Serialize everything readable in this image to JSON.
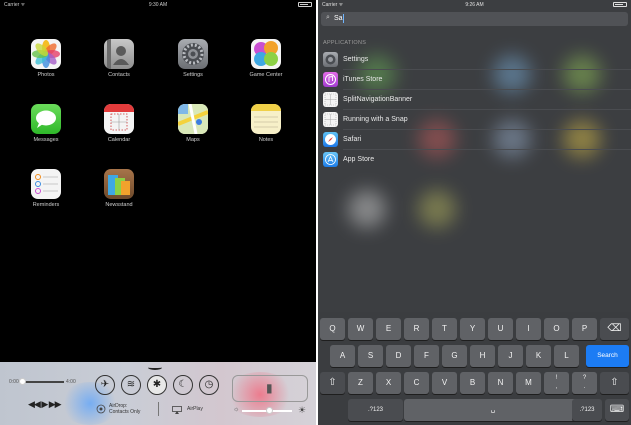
{
  "left": {
    "status": {
      "carrier": "Carrier ᯤ",
      "time": "9:30 AM"
    },
    "apps": [
      {
        "label": "Photos"
      },
      {
        "label": "Contacts"
      },
      {
        "label": "Settings"
      },
      {
        "label": "Game Center"
      },
      {
        "label": "Messages"
      },
      {
        "label": "Calendar"
      },
      {
        "label": "Maps"
      },
      {
        "label": "Notes"
      },
      {
        "label": "Reminders"
      },
      {
        "label": "Newsstand"
      }
    ],
    "control_center": {
      "time_start": "0:00",
      "time_end": "4:00",
      "toggles": [
        "✈",
        "≋",
        "✱",
        "☾",
        "◷"
      ],
      "airdrop_label": "AirDrop:",
      "airdrop_value": "Contacts Only",
      "airplay_label": "AirPlay",
      "transport": "◀◀ ▶ ▶▶",
      "brightness_fraction": 0.55,
      "scrub_fraction": 0.0
    }
  },
  "right": {
    "status": {
      "carrier": "Carrier ᯤ",
      "time": "9:26 AM"
    },
    "search": {
      "query": "Sa"
    },
    "section_header": "APPLICATIONS",
    "results": [
      {
        "label": "Settings",
        "icon": "settings-icon"
      },
      {
        "label": "iTunes Store",
        "icon": "itunes-icon"
      },
      {
        "label": "SplitNavigationBanner",
        "icon": "placeholder-app-icon"
      },
      {
        "label": "Running with a Snap",
        "icon": "placeholder-app-icon"
      },
      {
        "label": "Safari",
        "icon": "safari-icon"
      },
      {
        "label": "App Store",
        "icon": "app-store-icon"
      }
    ],
    "keyboard": {
      "row1": [
        "Q",
        "W",
        "E",
        "R",
        "T",
        "Y",
        "U",
        "I",
        "O",
        "P"
      ],
      "row2": [
        "A",
        "S",
        "D",
        "F",
        "G",
        "H",
        "J",
        "K",
        "L"
      ],
      "row3": [
        "Z",
        "X",
        "C",
        "V",
        "B",
        "N",
        "M",
        "!\n,",
        "?\n."
      ],
      "delete": "⌫",
      "search": "Search",
      "shift": "⇧",
      "numbers": ".?123",
      "space": "␣",
      "hide": "⌨"
    }
  }
}
